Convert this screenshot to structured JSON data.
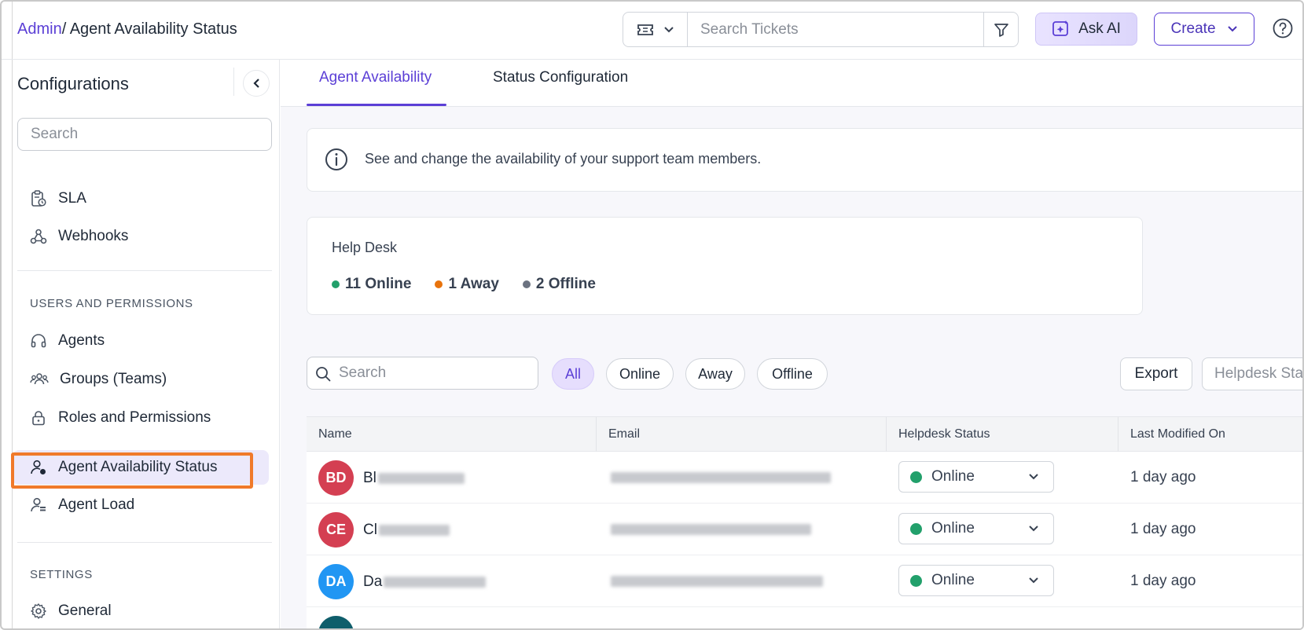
{
  "header": {
    "breadcrumb_root": "Admin",
    "breadcrumb_current": "/ Agent Availability Status",
    "search_placeholder": "Search Tickets",
    "ask_ai_label": "Ask AI",
    "create_label": "Create"
  },
  "sidebar": {
    "title": "Configurations",
    "search_placeholder": "Search",
    "items_top": [
      {
        "label": "SLA",
        "icon": "sla-clipboard-icon"
      },
      {
        "label": "Webhooks",
        "icon": "webhook-icon"
      }
    ],
    "section_users": "USERS AND PERMISSIONS",
    "items_users": [
      {
        "label": "Agents",
        "icon": "headset-icon"
      },
      {
        "label": "Groups (Teams)",
        "icon": "users-group-icon"
      },
      {
        "label": "Roles and Permissions",
        "icon": "lock-icon"
      },
      {
        "label": "Agent Availability Status",
        "icon": "user-status-icon",
        "active": true
      },
      {
        "label": "Agent Load",
        "icon": "user-load-icon"
      }
    ],
    "section_settings": "SETTINGS",
    "items_settings": [
      {
        "label": "General",
        "icon": "gear-icon"
      }
    ]
  },
  "tabs": [
    {
      "label": "Agent Availability",
      "active": true
    },
    {
      "label": "Status Configuration",
      "active": false
    }
  ],
  "info": {
    "text": "See and change the availability of your support team members."
  },
  "helpdesk": {
    "title": "Help Desk",
    "stats": [
      {
        "label": "11 Online",
        "color": "#22a06b"
      },
      {
        "label": "1 Away",
        "color": "#e8730c"
      },
      {
        "label": "2 Offline",
        "color": "#6b7280"
      }
    ]
  },
  "list": {
    "search_placeholder": "Search",
    "filters": [
      "All",
      "Online",
      "Away",
      "Offline"
    ],
    "active_filter": "All",
    "export_label": "Export",
    "status_filter_placeholder": "Helpdesk Sta"
  },
  "table": {
    "columns": [
      "Name",
      "Email",
      "Helpdesk Status",
      "Last Modified On"
    ],
    "rows": [
      {
        "initials": "BD",
        "avatar_color": "#d43f52",
        "name_visible": "Bl",
        "status": "Online",
        "modified": "1 day ago"
      },
      {
        "initials": "CE",
        "avatar_color": "#d43f52",
        "name_visible": "Cl",
        "status": "Online",
        "modified": "1 day ago"
      },
      {
        "initials": "DA",
        "avatar_color": "#2196f3",
        "name_visible": "Da",
        "status": "Online",
        "modified": "1 day ago"
      }
    ]
  },
  "colors": {
    "accent": "#5b3fd6",
    "online": "#22a06b",
    "away": "#e8730c",
    "offline": "#6b7280",
    "highlight": "#f07a2a"
  }
}
